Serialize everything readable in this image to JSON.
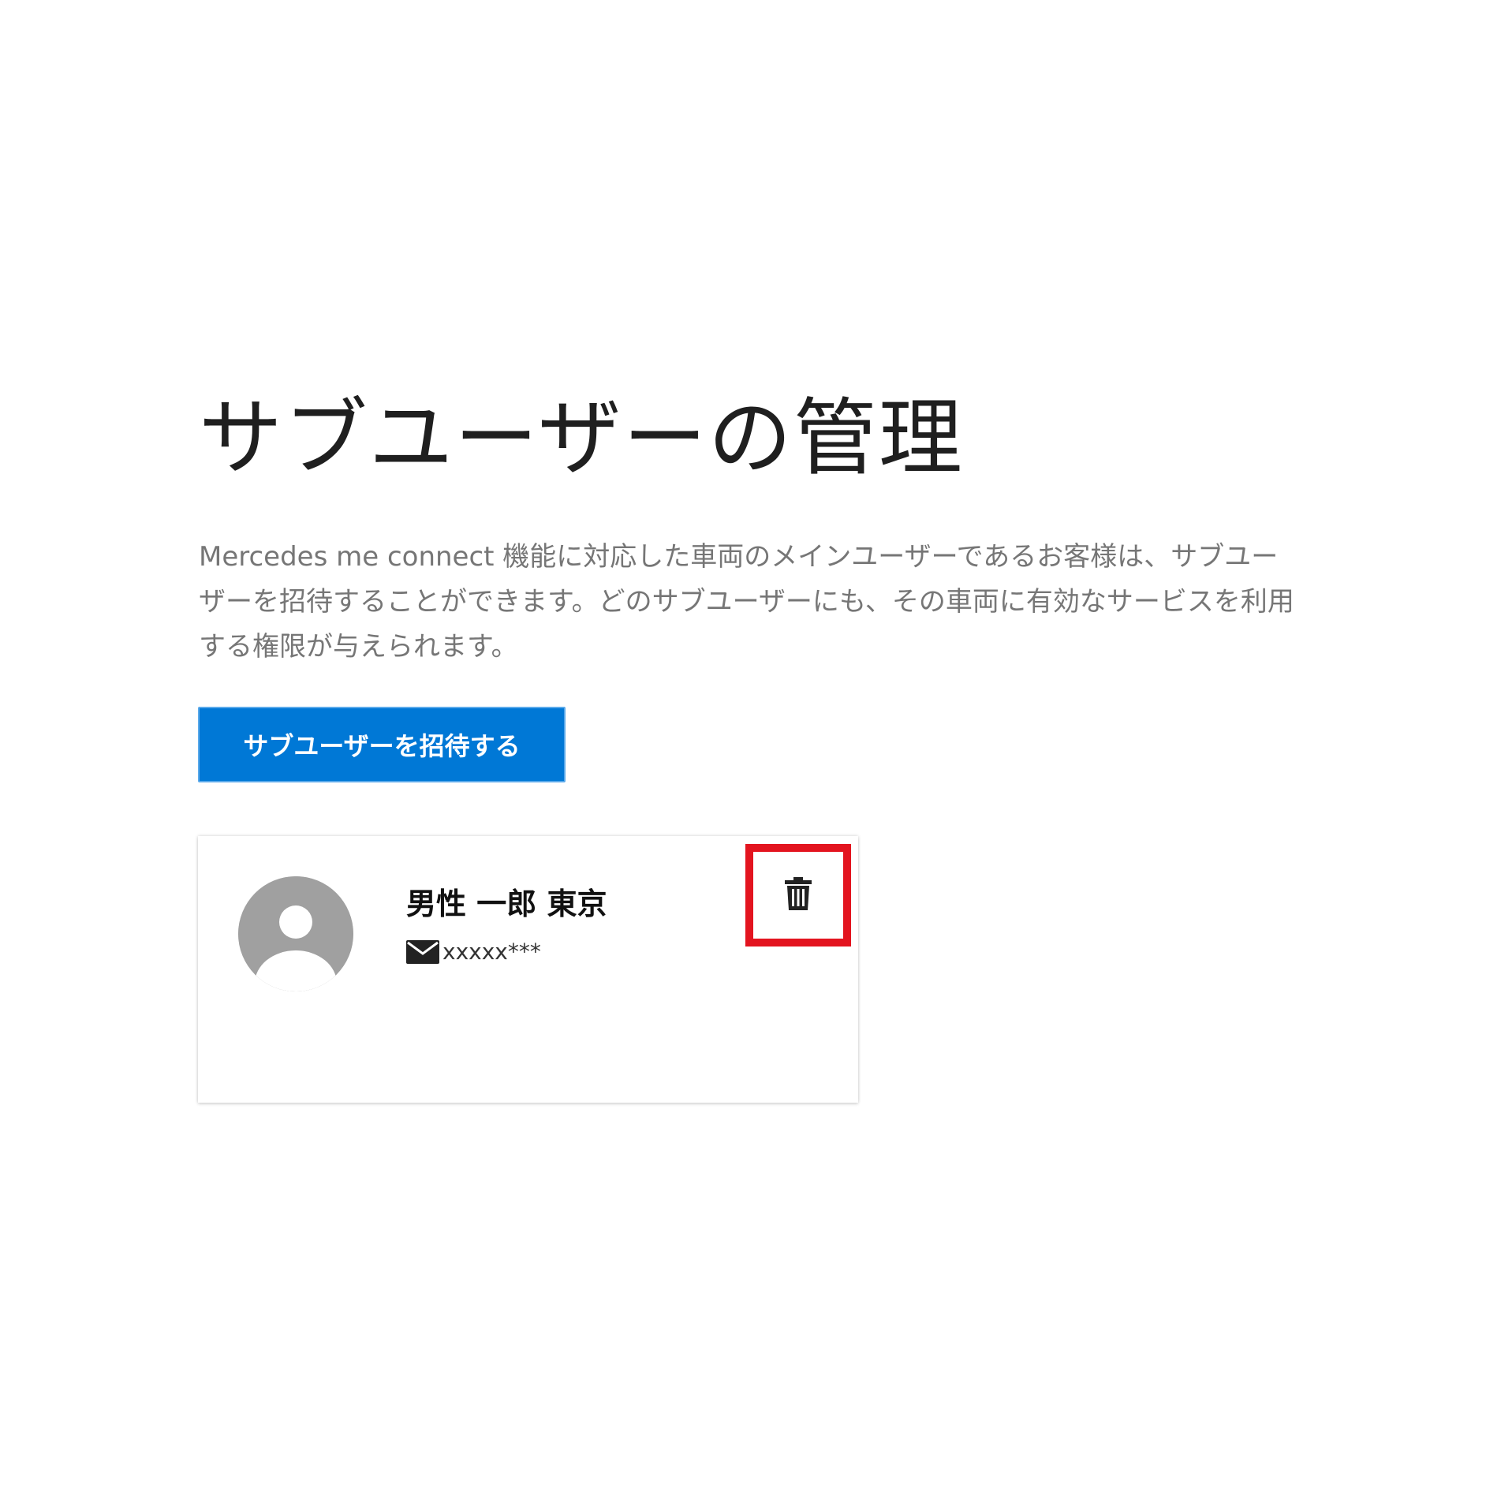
{
  "page": {
    "title": "サブユーザーの管理",
    "description": "Mercedes me connect 機能に対応した車両のメインユーザーであるお客様は、サブユーザーを招待することができます。どのサブユーザーにも、その車両に有効なサービスを利用する権限が与えられます。"
  },
  "actions": {
    "invite_label": "サブユーザーを招待する"
  },
  "sub_user": {
    "name": "男性 一郎 東京",
    "email": "xxxxx***",
    "avatar_icon": "user-avatar-icon",
    "email_icon": "envelope-icon",
    "delete_icon": "trash-icon"
  },
  "colors": {
    "accent": "#0078d6",
    "highlight": "#e3141f",
    "avatar": "#a0a0a0",
    "description_text": "#767676"
  }
}
